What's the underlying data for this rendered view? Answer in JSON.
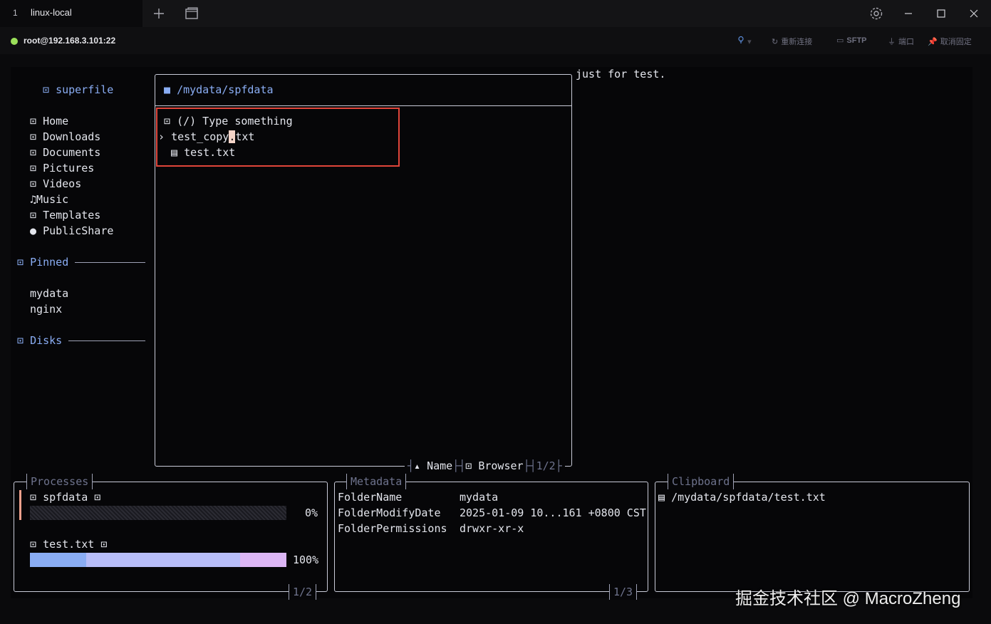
{
  "window": {
    "tab_number": "1",
    "tab_title": "linux-local"
  },
  "connection": {
    "label": "root@192.168.3.101:22",
    "status_color": "#9be05a",
    "actions": [
      {
        "icon": "bulb-icon",
        "label": ""
      },
      {
        "icon": "reconnect-icon",
        "label": "重新连接"
      },
      {
        "icon": "folder-icon",
        "label": "SFTP"
      },
      {
        "icon": "port-icon",
        "label": "端口"
      },
      {
        "icon": "pin-icon",
        "label": "取消固定"
      }
    ]
  },
  "sidebar": {
    "app_title": "superfile",
    "well_known": [
      {
        "icon": "home-icon",
        "label": "Home"
      },
      {
        "icon": "downloads-icon",
        "label": "Downloads"
      },
      {
        "icon": "documents-icon",
        "label": "Documents"
      },
      {
        "icon": "pictures-icon",
        "label": "Pictures"
      },
      {
        "icon": "videos-icon",
        "label": "Videos"
      },
      {
        "icon": "music-icon",
        "label": "Music"
      },
      {
        "icon": "templates-icon",
        "label": "Templates"
      },
      {
        "icon": "public-share-icon",
        "label": "PublicShare"
      }
    ],
    "pinned_title": "Pinned",
    "pinned": [
      "mydata",
      "nginx"
    ],
    "disks_title": "Disks"
  },
  "file_panel": {
    "path": "/mydata/spfdata",
    "search_placeholder": "(/) Type something",
    "files": [
      {
        "name": "test_copy.txt",
        "selected": true
      },
      {
        "name": "test.txt",
        "selected": false
      }
    ],
    "sort_label": "Name",
    "mode_label": "Browser",
    "page": "1/2"
  },
  "preview": {
    "text": "just for test."
  },
  "processes": {
    "title": "Processes",
    "items": [
      {
        "name": "spfdata",
        "progress": 0,
        "percent": "0%"
      },
      {
        "name": "test.txt",
        "progress": 1.0,
        "percent": "100%"
      }
    ],
    "page": "1/2"
  },
  "metadata": {
    "title": "Metadata",
    "rows": [
      {
        "key": "FolderName",
        "value": "mydata"
      },
      {
        "key": "FolderModifyDate",
        "value": "2025-01-09 10...161 +0800 CST"
      },
      {
        "key": "FolderPermissions",
        "value": "drwxr-xr-x"
      }
    ],
    "page": "1/3"
  },
  "clipboard": {
    "title": "Clipboard",
    "items": [
      "/mydata/spfdata/test.txt"
    ]
  },
  "watermark": "掘金技术社区 @ MacroZheng",
  "colors": {
    "accent_blue": "#8aadf4",
    "selection_red": "#e0453a",
    "gauge_start": "#8aadf4",
    "gauge_mid": "#b7bdf8",
    "gauge_end": "#dcb6f5"
  }
}
